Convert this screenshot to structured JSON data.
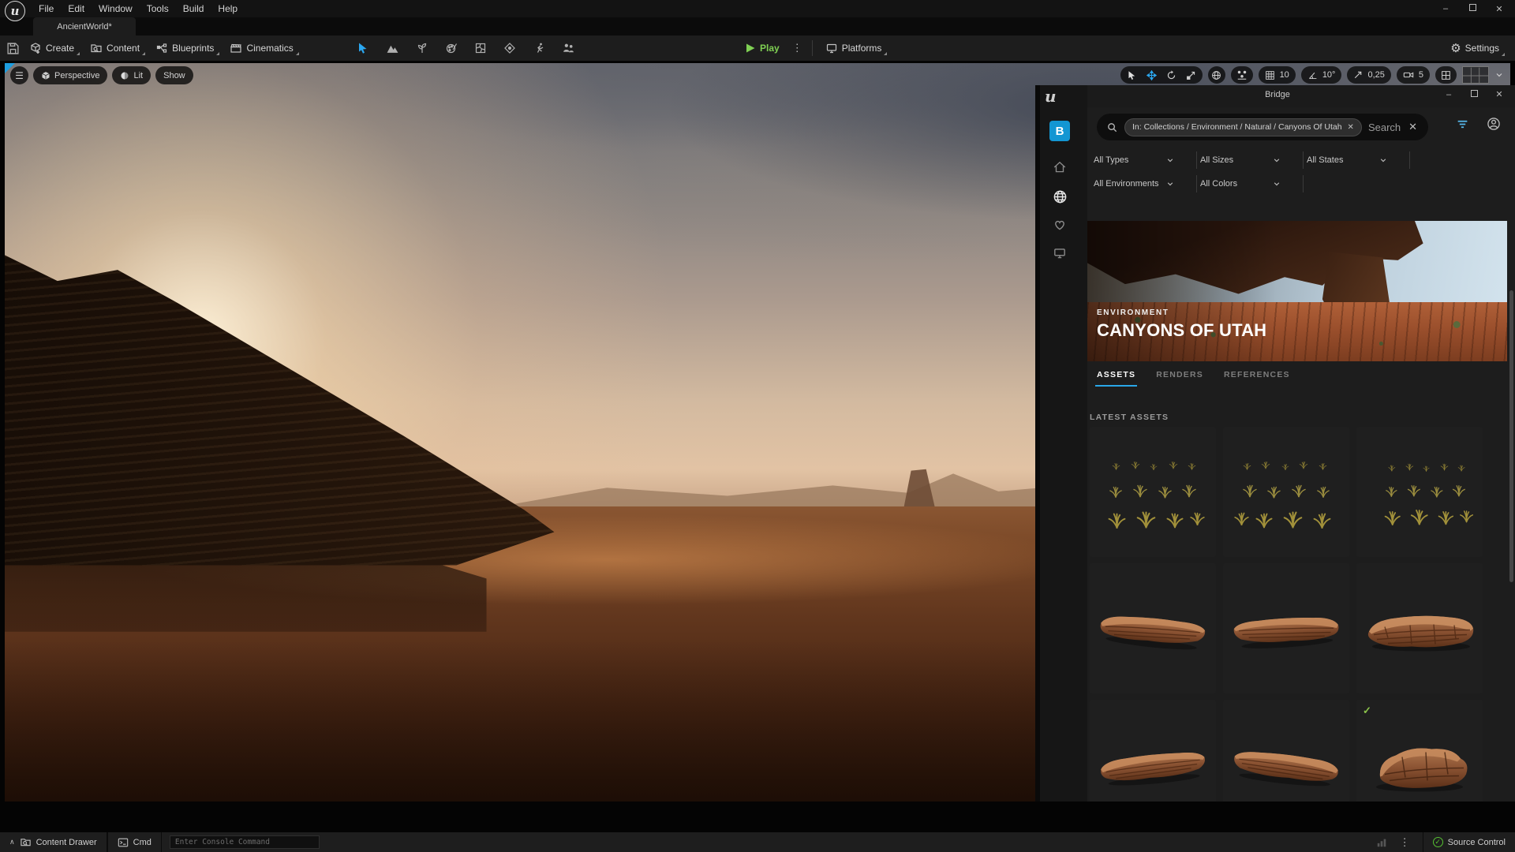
{
  "menu": {
    "items": [
      "File",
      "Edit",
      "Window",
      "Tools",
      "Build",
      "Help"
    ]
  },
  "app": {
    "level_tab": "AncientWorld*"
  },
  "toolbar": {
    "create": "Create",
    "content": "Content",
    "blueprints": "Blueprints",
    "cinematics": "Cinematics",
    "play": "Play",
    "platforms": "Platforms",
    "settings": "Settings"
  },
  "viewport_bar": {
    "perspective": "Perspective",
    "lit": "Lit",
    "show": "Show",
    "grid_snap": "10",
    "angle_snap": "10°",
    "scale_snap": "0,25",
    "camera_speed": "5"
  },
  "bridge": {
    "window_title": "Bridge",
    "search_chip": "In: Collections / Environment / Natural / Canyons Of Utah",
    "search_placeholder": "Search",
    "filters": {
      "types": "All Types",
      "sizes": "All Sizes",
      "states": "All States",
      "environments": "All Environments",
      "colors": "All Colors"
    },
    "hero": {
      "category": "ENVIRONMENT",
      "title": "CANYONS OF UTAH"
    },
    "tabs": [
      "ASSETS",
      "RENDERS",
      "REFERENCES"
    ],
    "active_tab": "ASSETS",
    "section_title": "LATEST ASSETS",
    "assets": [
      {
        "kind": "grass-atlas"
      },
      {
        "kind": "grass-atlas"
      },
      {
        "kind": "grass-atlas"
      },
      {
        "kind": "rock-slab"
      },
      {
        "kind": "rock-slab"
      },
      {
        "kind": "rock-platform"
      },
      {
        "kind": "rock-slab"
      },
      {
        "kind": "rock-slab"
      },
      {
        "kind": "rock-chunk",
        "downloaded": true
      }
    ]
  },
  "status_bar": {
    "content_drawer": "Content Drawer",
    "cmd": "Cmd",
    "console_placeholder": "Enter Console Command",
    "source_control": "Source Control"
  },
  "colors": {
    "accent_blue": "#2aa7e8",
    "bridge_blue": "#1396d3",
    "play_green": "#7fd053",
    "check_green": "#8bc34a",
    "source_green": "#57c232"
  }
}
